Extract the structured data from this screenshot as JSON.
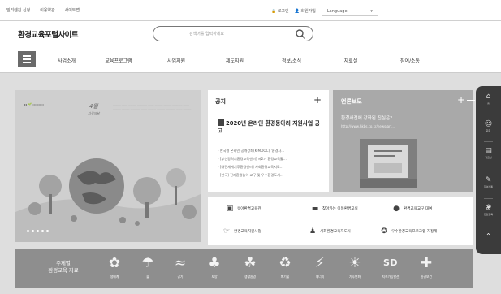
{
  "utility": {
    "links": [
      "빌리렌진 신청",
      "이용약관",
      "사이트맵"
    ],
    "login": "로그인",
    "signup": "회원가입",
    "language": "Language"
  },
  "header": {
    "logo": "환경교육포털사이트",
    "search_placeholder": "검색어를 입력하세요"
  },
  "nav": {
    "items": [
      "사업소개",
      "교육프로그램",
      "사업지원",
      "제도지원",
      "정보/소식",
      "자료실",
      "참여/소통"
    ]
  },
  "banner": {
    "month": "4월",
    "month_sub": "지구의날",
    "pages": 5
  },
  "notice": {
    "heading": "공지",
    "featured_title": "2020년 온라인 환경동아리 지원사업 공고",
    "items": [
      "- 한국형 온라인 공개강좌(K-MOOC) '환경사...",
      "- [부산광역시환경교육센터] 제2기 환경교육활...",
      "- [대전세계기후환경센터] 사회환경교육지도...",
      "- [한국] 진제환경놀이 교구 및 우수환경도서..."
    ]
  },
  "press": {
    "heading": "언론보도",
    "title": "환경사전에 강화된 진실은?",
    "url": "http://www.hkbs.co.kr/news/art..."
  },
  "quick_links": [
    {
      "label": "유아환경교육관",
      "icon": "book-icon"
    },
    {
      "label": "찾아가는 이동환경교실",
      "icon": "bus-icon"
    },
    {
      "label": "환경교육교구 대여",
      "icon": "globe-icon"
    },
    {
      "label": "환경교육지원사업",
      "icon": "hand-icon"
    },
    {
      "label": "사회환경교육지도사",
      "icon": "teacher-icon"
    },
    {
      "label": "우수환경교육프로그램 지정제",
      "icon": "award-icon"
    }
  ],
  "themes": {
    "label_line1": "주제별",
    "label_line2": "환경교육 자료",
    "items": [
      {
        "label": "생태계",
        "glyph": "✿"
      },
      {
        "label": "물",
        "glyph": "☂"
      },
      {
        "label": "공기",
        "glyph": "≈"
      },
      {
        "label": "토양",
        "glyph": "♣"
      },
      {
        "label": "생활환경",
        "glyph": "☘"
      },
      {
        "label": "폐기물",
        "glyph": "♻"
      },
      {
        "label": "에너지",
        "glyph": "⚡"
      },
      {
        "label": "기후변화",
        "glyph": "☀"
      },
      {
        "label": "지속가능발전",
        "glyph": "SD"
      },
      {
        "label": "환경보건",
        "glyph": "✚"
      }
    ]
  },
  "quickmenu": [
    {
      "label": "홈",
      "glyph": "⌂"
    },
    {
      "label": "회원",
      "glyph": "☺"
    },
    {
      "label": "자료실",
      "glyph": "▤"
    },
    {
      "label": "참여소통",
      "glyph": "✎"
    },
    {
      "label": "환경교육",
      "glyph": "❀"
    }
  ]
}
